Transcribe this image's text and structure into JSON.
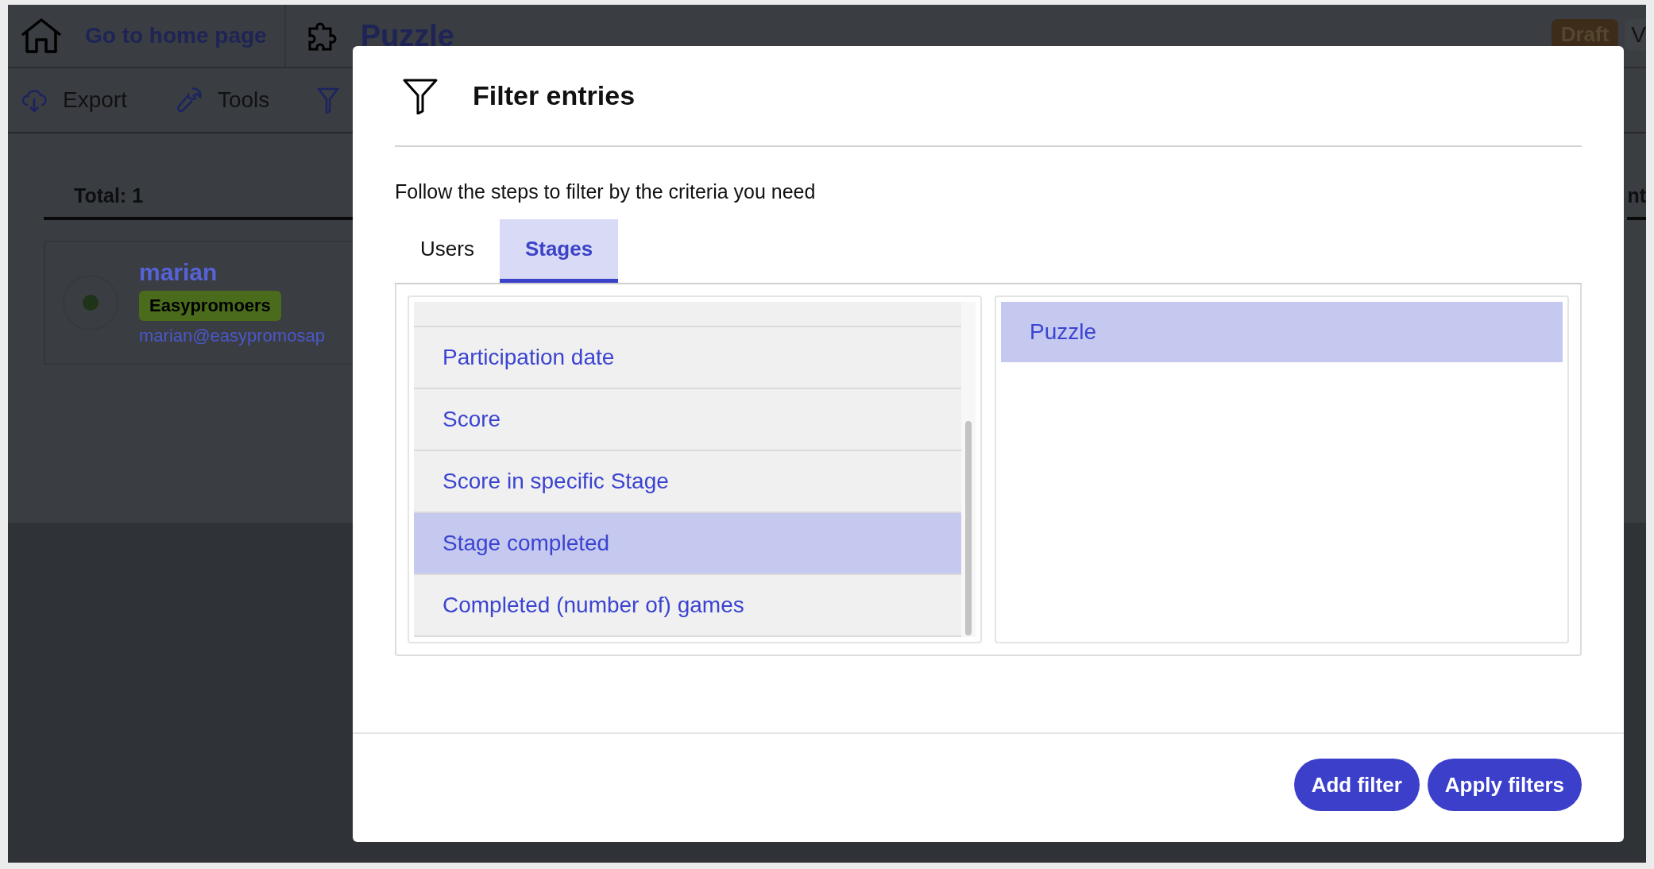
{
  "header": {
    "home_link": "Go to home page",
    "title": "Puzzle",
    "status_badge": "Draft",
    "cut_button": "V"
  },
  "toolbar": [
    {
      "kind": "export",
      "label": "Export"
    },
    {
      "kind": "tools",
      "label": "Tools"
    },
    {
      "kind": "filter"
    }
  ],
  "summary": {
    "total": "Total: 1",
    "column_2": "nt"
  },
  "entry": {
    "name": "marian",
    "tag": "Easypromoers",
    "email": "marian@easypromosap"
  },
  "modal": {
    "title": "Filter entries",
    "instruction": "Follow the steps to filter by the criteria you need",
    "tabs": [
      {
        "label": "Users",
        "selected": false
      },
      {
        "label": "Stages",
        "selected": true
      }
    ],
    "criteria": [
      {
        "label": "Participation date",
        "selected": false
      },
      {
        "label": "Score",
        "selected": false
      },
      {
        "label": "Score in specific Stage",
        "selected": false
      },
      {
        "label": "Stage completed",
        "selected": true
      },
      {
        "label": "Completed (number of) games",
        "selected": false
      }
    ],
    "stages": [
      {
        "label": "Puzzle",
        "selected": true
      }
    ],
    "buttons": [
      "Add filter",
      "Apply filters"
    ]
  }
}
